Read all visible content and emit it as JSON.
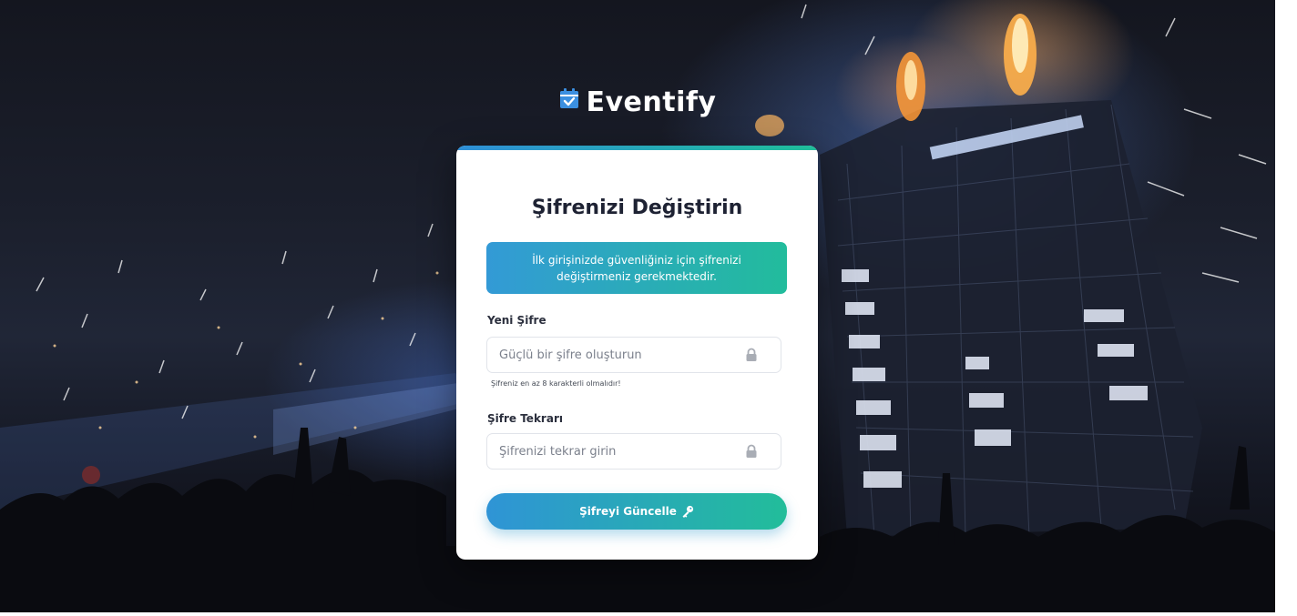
{
  "brand": {
    "name": "Eventify",
    "icon": "calendar-check-icon",
    "icon_color": "#3b8fe0"
  },
  "form": {
    "title": "Şifrenizi Değiştirin",
    "alert": "İlk girişinizde güvenliğiniz için şifrenizi değiştirmeniz gerekmektedir.",
    "new_password": {
      "label": "Yeni Şifre",
      "placeholder": "Güçlü bir şifre oluşturun",
      "value": "",
      "icon": "lock-icon",
      "hint": "Şifreniz en az 8 karakterli olmalıdır!"
    },
    "confirm_password": {
      "label": "Şifre Tekrarı",
      "placeholder": "Şifrenizi tekrar girin",
      "value": "",
      "icon": "lock-icon"
    },
    "submit": {
      "label": "Şifreyi Güncelle",
      "icon": "key-icon"
    }
  },
  "colors": {
    "gradient_start": "#2f94d6",
    "gradient_end": "#22bd9a",
    "title_text": "#1e2233"
  }
}
